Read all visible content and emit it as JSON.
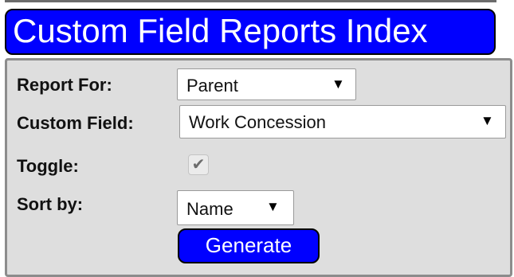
{
  "page": {
    "title": "Custom Field Reports Index"
  },
  "form": {
    "report_for": {
      "label": "Report For:",
      "selected": "Parent"
    },
    "custom_field": {
      "label": "Custom Field:",
      "selected": "Work Concession"
    },
    "toggle": {
      "label": "Toggle:",
      "checked": true
    },
    "sort_by": {
      "label": "Sort by:",
      "selected": "Name"
    },
    "generate_label": "Generate"
  },
  "icons": {
    "dropdown": "dropdown-arrow-icon",
    "check": "checkmark-icon"
  },
  "colors": {
    "accent": "#0000ff",
    "panel_background": "#dedede",
    "panel_border": "#8c8c8c",
    "button_text": "#ffffff"
  }
}
